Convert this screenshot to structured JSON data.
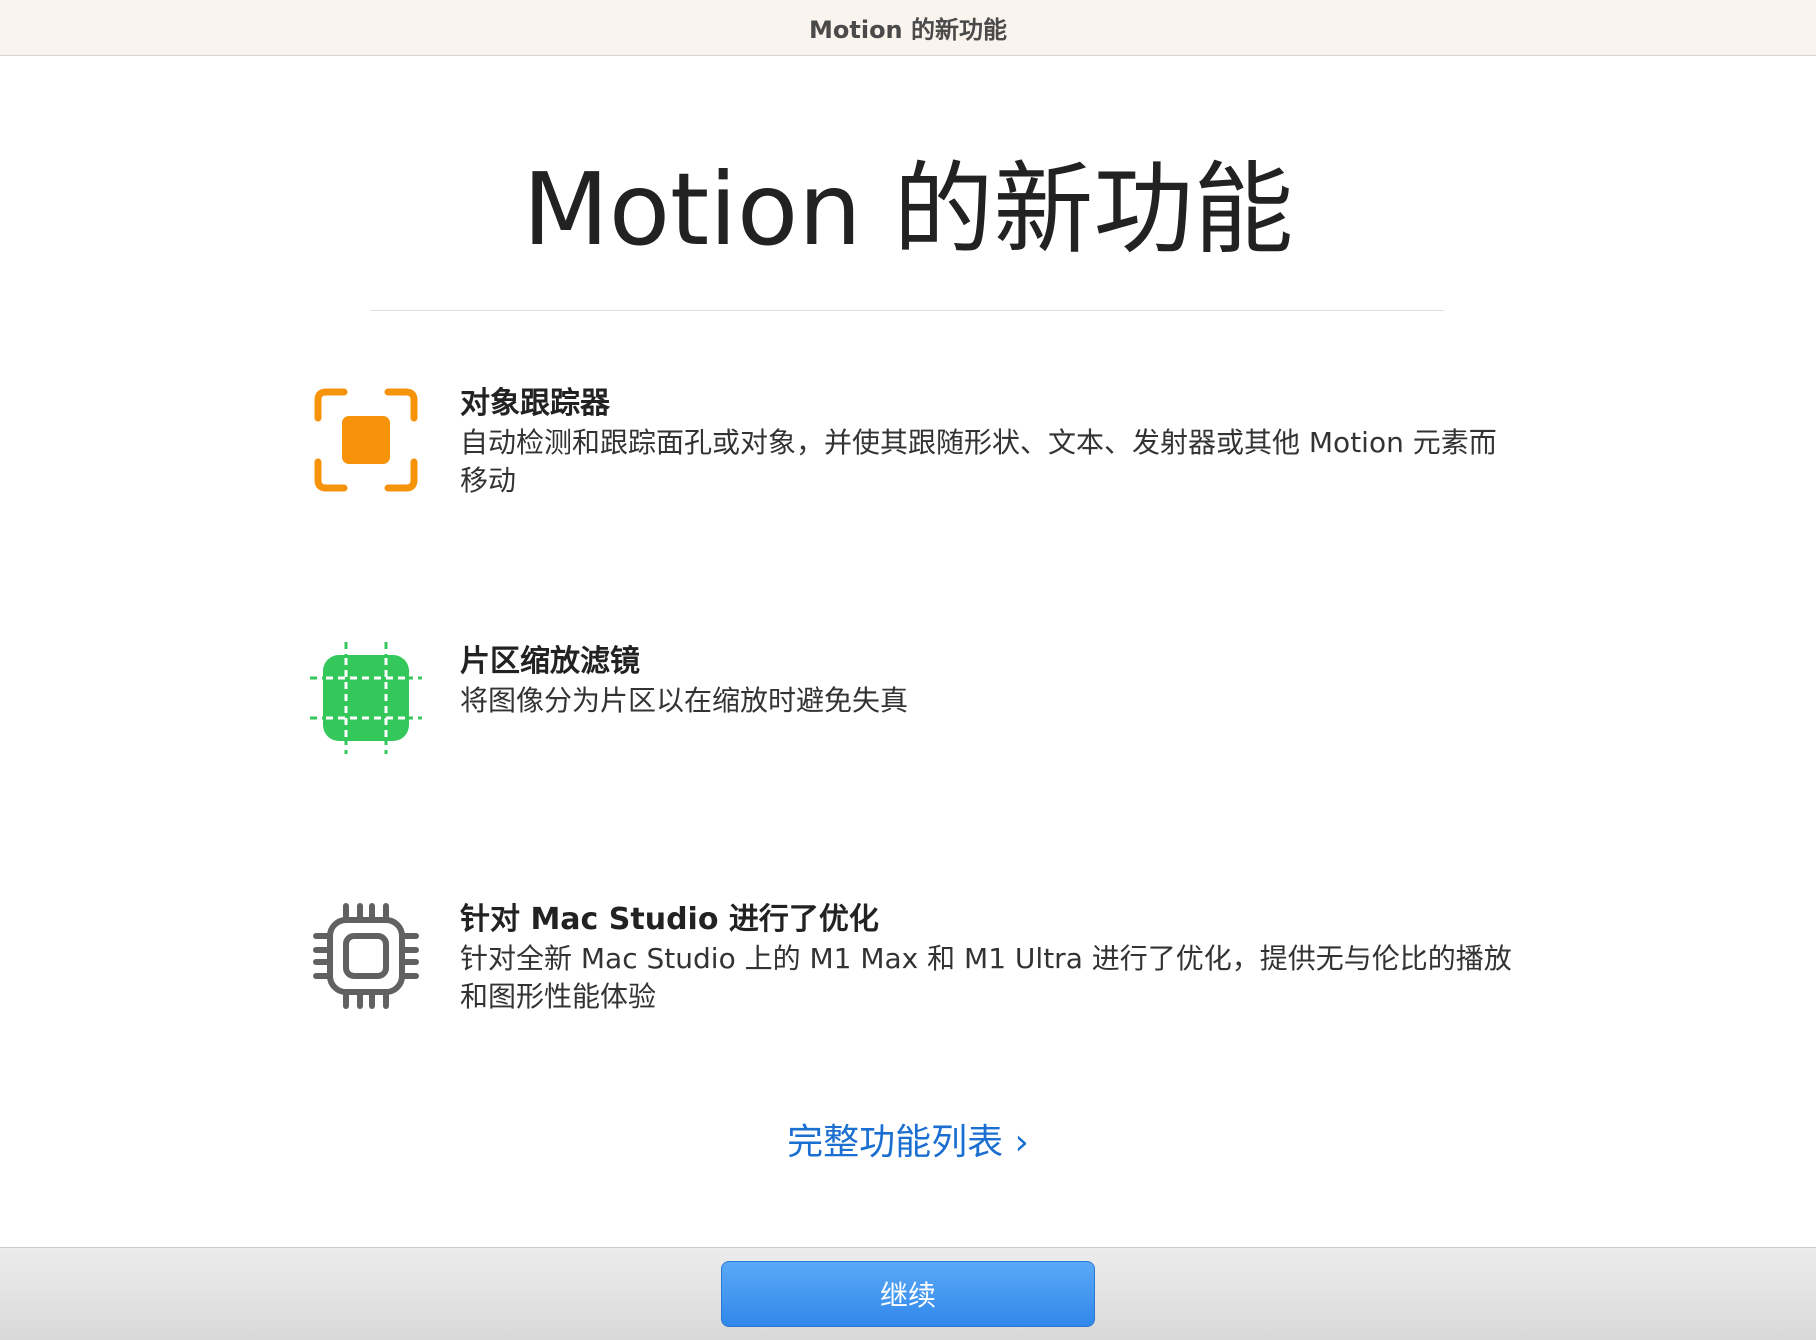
{
  "window": {
    "title": "Motion 的新功能"
  },
  "main": {
    "heading": "Motion 的新功能",
    "features": [
      {
        "icon": "object-tracker-icon",
        "title": "对象跟踪器",
        "description": "自动检测和跟踪面孔或对象，并使其跟随形状、文本、发射器或其他 Motion 元素而移动"
      },
      {
        "icon": "tile-scale-filter-icon",
        "title": "片区缩放滤镜",
        "description": "将图像分为片区以在缩放时避免失真"
      },
      {
        "icon": "chip-icon",
        "title": "针对 Mac Studio 进行了优化",
        "description": "针对全新 Mac Studio 上的 M1 Max 和 M1 Ultra 进行了优化，提供无与伦比的播放和图形性能体验"
      }
    ],
    "full_list_link": "完整功能列表 ›"
  },
  "footer": {
    "continue_label": "继续"
  },
  "colors": {
    "accent": "#1a6fd1",
    "tracker_orange": "#f7930a",
    "tile_green": "#34c759",
    "chip_gray": "#616161",
    "button_blue": "#3288ea"
  }
}
